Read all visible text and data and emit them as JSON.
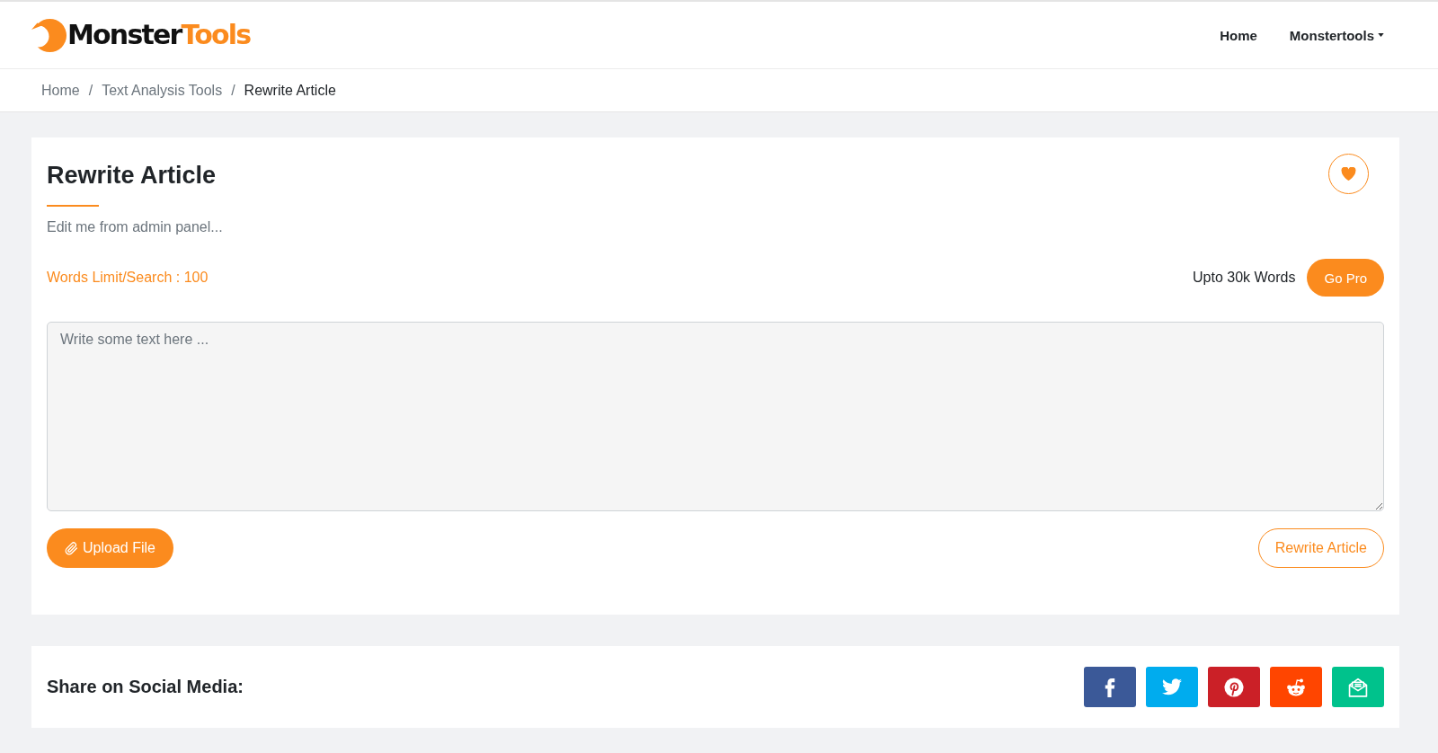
{
  "header": {
    "logo": {
      "text": "Monster",
      "accent": "Tools"
    },
    "nav": [
      {
        "label": "Home",
        "kind": "link"
      },
      {
        "label": "Monstertools",
        "kind": "dropdown"
      }
    ]
  },
  "breadcrumb": {
    "items": [
      {
        "label": "Home",
        "current": false
      },
      {
        "label": "Text Analysis Tools",
        "current": false
      },
      {
        "label": "Rewrite Article",
        "current": true
      }
    ],
    "separators": [
      "/",
      "/"
    ]
  },
  "tool": {
    "title": "Rewrite Article",
    "description": "Edit me from admin panel...",
    "limit": "Words Limit/Search : 100",
    "upgrade": {
      "note": "Upto 30k Words",
      "button": "Go Pro"
    },
    "editor": {
      "placeholder": "Write some text here ..."
    },
    "actions": [
      {
        "label": "Upload File",
        "kind": "upload"
      },
      {
        "label": "Rewrite Article",
        "kind": "submit"
      }
    ]
  },
  "share": {
    "title": "Share on Social Media:",
    "networks": [
      {
        "kind": "facebook",
        "color": "#3b5998"
      },
      {
        "kind": "twitter",
        "color": "#00acee"
      },
      {
        "kind": "pinterest",
        "color": "#cb2027"
      },
      {
        "kind": "reddit",
        "color": "#ff4500"
      },
      {
        "kind": "email",
        "color": "#00c28c"
      }
    ]
  }
}
